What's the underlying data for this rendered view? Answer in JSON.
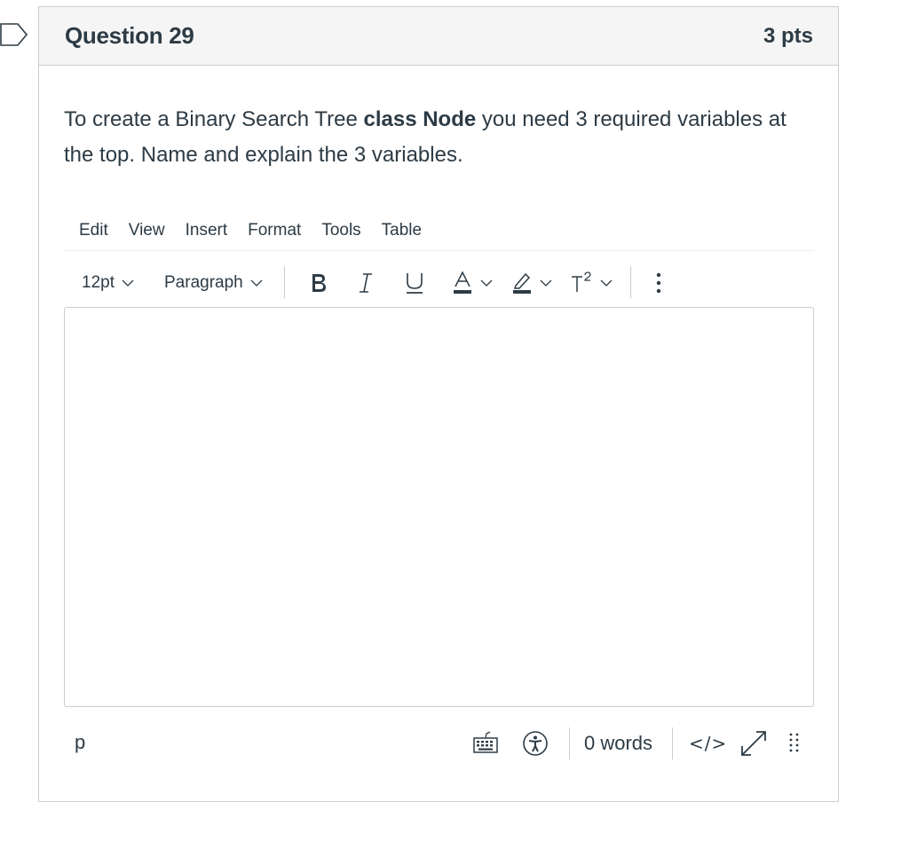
{
  "question": {
    "title": "Question 29",
    "points": "3 pts",
    "text_before": "To create a Binary Search Tree ",
    "text_bold": "class Node",
    "text_after": " you need 3 required variables at the top. Name and explain the 3 variables."
  },
  "editor": {
    "menu": [
      "Edit",
      "View",
      "Insert",
      "Format",
      "Tools",
      "Table"
    ],
    "font_size": "12pt",
    "block_format": "Paragraph",
    "toolbar_icons": [
      "bold-icon",
      "italic-icon",
      "underline-icon",
      "text-color-icon",
      "highlight-icon",
      "superscript-icon",
      "more-icon"
    ],
    "status_path": "p",
    "word_count": "0 words",
    "html_toggle": "</>",
    "status_icons": [
      "keyboard-icon",
      "accessibility-icon",
      "fullscreen-icon",
      "resize-grip-icon"
    ],
    "body_text": ""
  },
  "colors": {
    "text": "#2d3b45",
    "border": "#c7cdd1",
    "header_bg": "#f5f5f5",
    "flag": "#2d3b45"
  }
}
